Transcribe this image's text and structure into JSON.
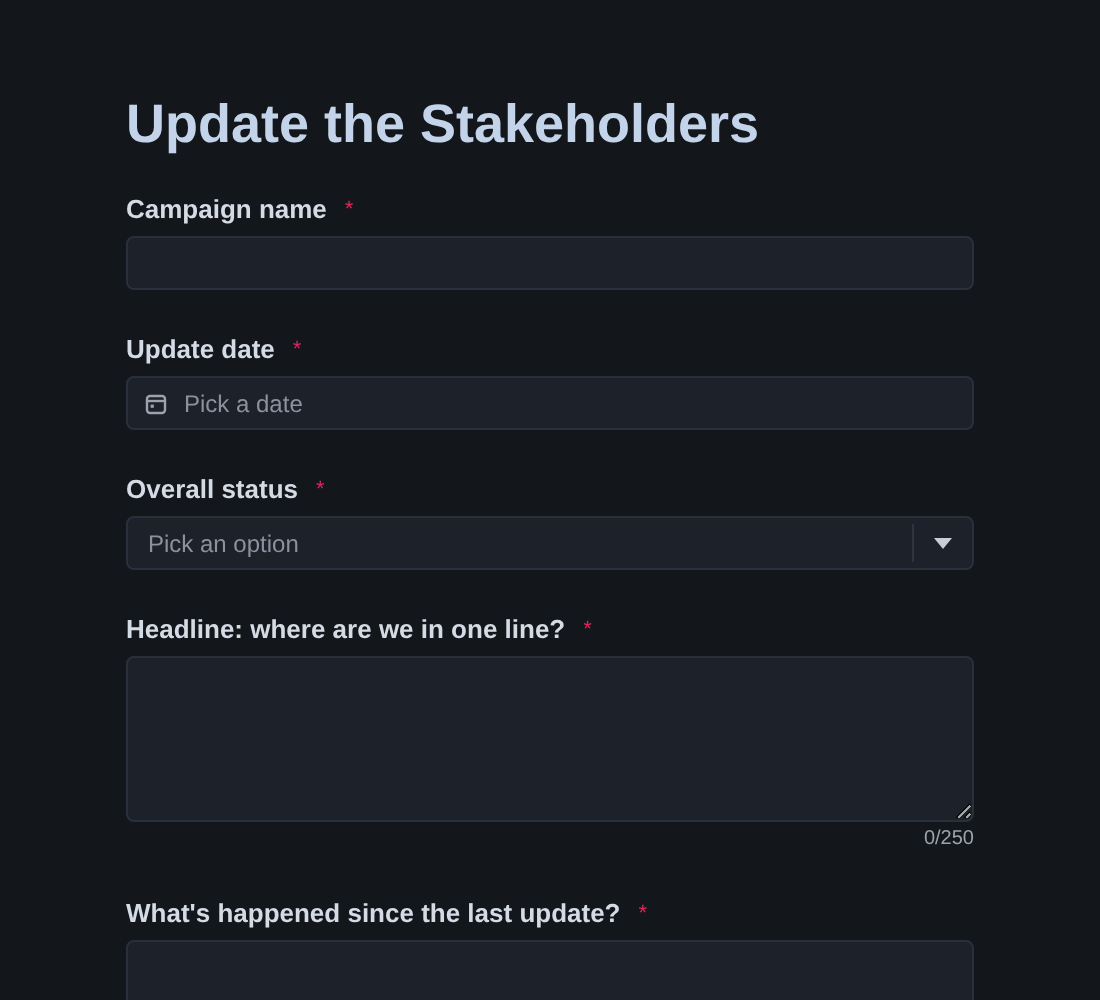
{
  "title": "Update the Stakeholders",
  "fields": [
    {
      "kind": "text",
      "label": "Campaign name",
      "required_mark": "*"
    },
    {
      "kind": "date",
      "label": "Update date",
      "required_mark": "*",
      "placeholder": "Pick a date"
    },
    {
      "kind": "select",
      "label": "Overall status",
      "required_mark": "*",
      "placeholder": "Pick an option"
    },
    {
      "kind": "textarea",
      "label": "Headline: where are we in one line?",
      "required_mark": "*",
      "counter": "0/250"
    },
    {
      "kind": "textarea",
      "label": "What's happened since the last update?",
      "required_mark": "*"
    }
  ]
}
